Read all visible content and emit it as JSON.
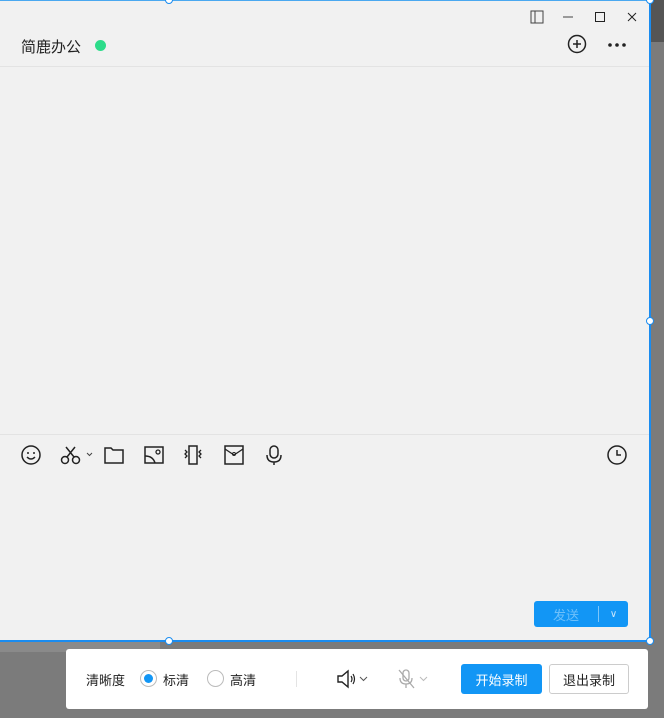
{
  "chat": {
    "title": "简鹿办公",
    "status_color": "#2ddc8a"
  },
  "window_controls": [
    "sidebar-toggle",
    "minimize",
    "maximize",
    "close"
  ],
  "toolbar": [
    "emoji",
    "screenshot",
    "file",
    "image",
    "shake",
    "red-packet",
    "voice",
    "history"
  ],
  "send": {
    "label": "发送"
  },
  "recorder": {
    "quality_label": "清晰度",
    "options": [
      {
        "label": "标清",
        "selected": true
      },
      {
        "label": "高清",
        "selected": false
      }
    ],
    "start_label": "开始录制",
    "exit_label": "退出录制",
    "accent": "#1296f5"
  }
}
